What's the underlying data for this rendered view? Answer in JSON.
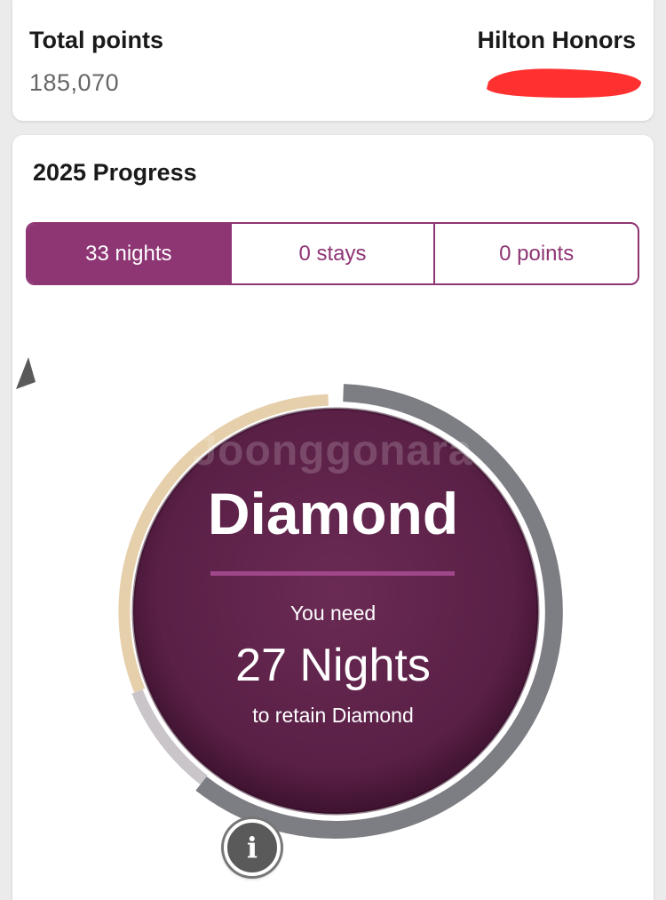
{
  "summary": {
    "total_points_label": "Total points",
    "total_points_value": "185,070",
    "program_name": "Hilton Honors"
  },
  "progress": {
    "title": "2025 Progress",
    "tabs": [
      {
        "label": "33 nights",
        "active": true
      },
      {
        "label": "0 stays",
        "active": false
      },
      {
        "label": "0 points",
        "active": false
      }
    ]
  },
  "gauge": {
    "tier": "Diamond",
    "need_label": "You need",
    "need_value": "27 Nights",
    "need_suffix": "to retain Diamond",
    "watermark": "Joonggonara",
    "nights_completed": 33,
    "nights_remaining": 27,
    "colors": {
      "earned_arc": "#e6d0ac",
      "remaining_arc": "#7d7e83",
      "faded_arc": "#c9c5c9",
      "circle_fill": "#5e2349",
      "accent": "#8e3574"
    }
  },
  "colors": {
    "redaction": "#ff3030"
  }
}
